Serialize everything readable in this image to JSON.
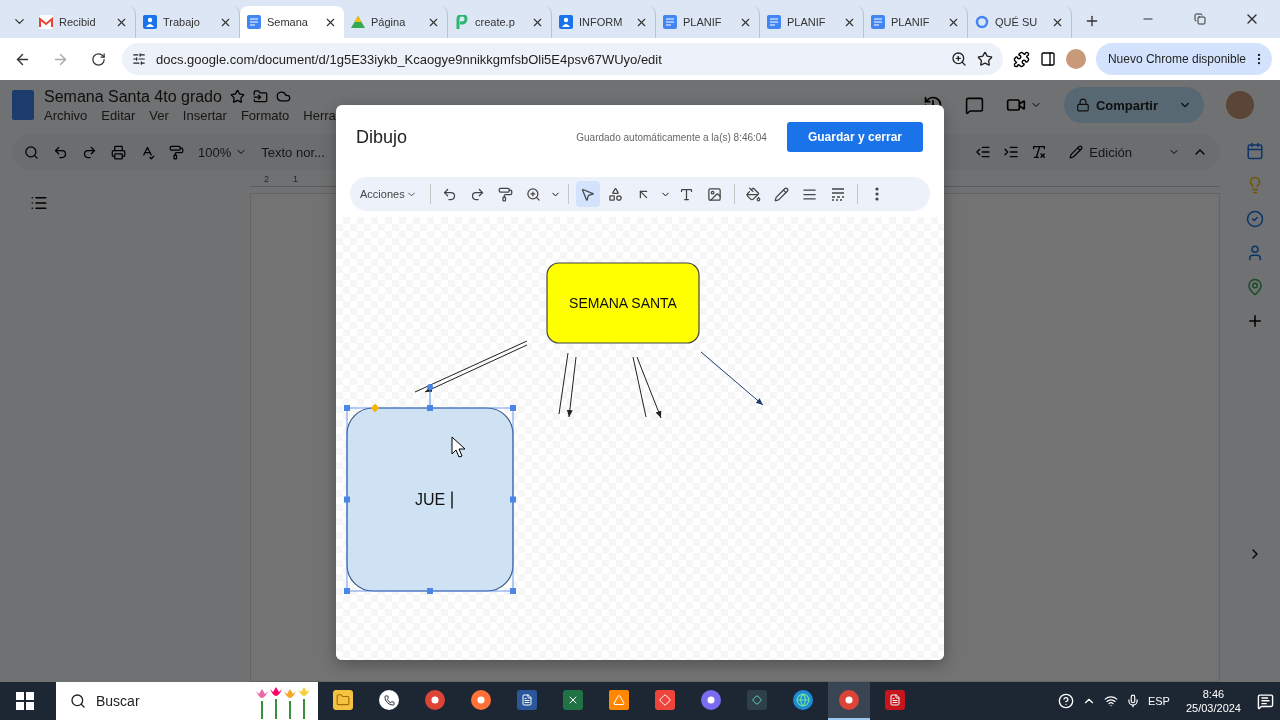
{
  "browser": {
    "tabs": [
      {
        "title": "Recibid",
        "kind": "mail",
        "selected": false
      },
      {
        "title": "Trabajo",
        "kind": "person",
        "selected": false
      },
      {
        "title": "Semana",
        "kind": "doc",
        "selected": true
      },
      {
        "title": "Página",
        "kind": "drive",
        "selected": false
      },
      {
        "title": "create.p",
        "kind": "p",
        "selected": false
      },
      {
        "title": "INFORM",
        "kind": "person",
        "selected": false
      },
      {
        "title": "PLANIF",
        "kind": "doc",
        "selected": false
      },
      {
        "title": "PLANIF",
        "kind": "doc",
        "selected": false
      },
      {
        "title": "PLANIF",
        "kind": "doc",
        "selected": false
      },
      {
        "title": "QUÉ SU",
        "kind": "google",
        "selected": false
      }
    ],
    "url": "docs.google.com/document/d/1g5E33iykb_Kcaogye9nnikkgmfsbOli5E4psv67WUyo/edit",
    "update_button": "Nuevo Chrome disponible"
  },
  "document": {
    "title": "Semana Santa 4to grado",
    "menus": [
      "Archivo",
      "Editar",
      "Ver",
      "Insertar",
      "Formato",
      "Herra"
    ],
    "share_button": "Compartir",
    "zoom": "100%",
    "style": "Texto nor...",
    "mode": "Edición",
    "ruler_marks": [
      "2",
      "1"
    ]
  },
  "drawing_dialog": {
    "title": "Dibujo",
    "autosave": "Guardado automáticamente a la(s) 8:46:04",
    "save_button": "Guardar y cerrar",
    "actions_menu": "Acciones",
    "tools": [
      {
        "kind": "undo",
        "selected": false
      },
      {
        "kind": "redo",
        "selected": false
      },
      {
        "kind": "paint-format",
        "selected": false
      },
      {
        "kind": "zoom",
        "selected": false
      },
      {
        "kind": "select",
        "selected": true
      },
      {
        "kind": "shape",
        "selected": false
      },
      {
        "kind": "line",
        "selected": false
      },
      {
        "kind": "text-box",
        "selected": false
      },
      {
        "kind": "image",
        "selected": false
      },
      {
        "kind": "fill",
        "selected": false
      },
      {
        "kind": "border-color",
        "selected": false
      },
      {
        "kind": "border-weight",
        "selected": false
      },
      {
        "kind": "border-dash",
        "selected": false
      },
      {
        "kind": "more",
        "selected": false
      }
    ],
    "shapes": [
      {
        "text": "SEMANA SANTA",
        "color": "#ffff00",
        "selected": false
      },
      {
        "text": "JUE",
        "color": "#cfe2f3",
        "selected": true
      }
    ]
  },
  "taskbar": {
    "search": "Buscar",
    "apps": [
      {
        "kind": "folder",
        "selected": false
      },
      {
        "kind": "whatsapp",
        "selected": false
      },
      {
        "kind": "chrome",
        "selected": false
      },
      {
        "kind": "firefox",
        "selected": false
      },
      {
        "kind": "word",
        "selected": false
      },
      {
        "kind": "excel",
        "selected": false
      },
      {
        "kind": "vlc",
        "selected": false
      },
      {
        "kind": "remote",
        "selected": false
      },
      {
        "kind": "drop",
        "selected": false
      },
      {
        "kind": "editor",
        "selected": false
      },
      {
        "kind": "edge",
        "selected": false
      },
      {
        "kind": "chrome",
        "selected": true
      },
      {
        "kind": "pdf",
        "selected": false
      }
    ],
    "language": "ESP",
    "time": "8:46",
    "date": "25/03/2024"
  }
}
